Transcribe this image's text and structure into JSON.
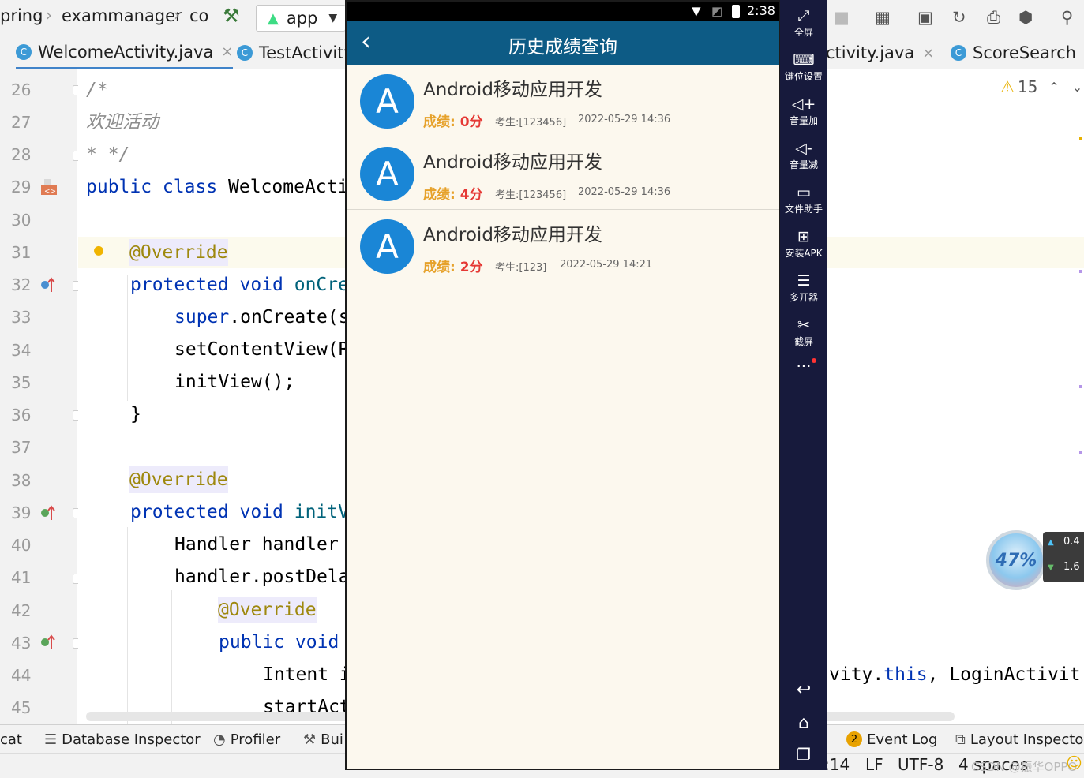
{
  "ide": {
    "breadcrumbs": [
      "pring",
      "exammanager",
      "co"
    ],
    "run_config": "app",
    "tabs": [
      {
        "label": "WelcomeActivity.java",
        "badge": "C"
      },
      {
        "label": "TestActivity",
        "badge": "C"
      },
      {
        "label": "ctivity.java",
        "badge": ""
      },
      {
        "label": "ScoreSearch",
        "badge": "C"
      }
    ],
    "warnings_count": "15",
    "line_numbers": [
      "26",
      "27",
      "28",
      "29",
      "30",
      "31",
      "32",
      "33",
      "34",
      "35",
      "36",
      "37",
      "38",
      "39",
      "40",
      "41",
      "42",
      "43",
      "44",
      "45"
    ],
    "code": {
      "l26": "/*",
      "l27": "欢迎活动",
      "l28": "* */",
      "l29_kw": "public class",
      "l29_name": " WelcomeActi",
      "l31": "@Override",
      "l32_kw": "protected void",
      "l32_name": " onCre",
      "l33_kw": "super",
      "l33_rest": ".onCreate(s",
      "l34": "setContentView(R",
      "l35": "initView();",
      "l36": "}",
      "l38": "@Override",
      "l39_kw": "protected void",
      "l39_name": " initV",
      "l40": "Handler handler",
      "l41": "handler.postDela",
      "l42": "@Override",
      "l43_kw": "public void",
      "l44": "Intent i",
      "l44_right_a": "vity.",
      "l44_right_kw": "this",
      "l44_right_b": ", LoginActivit",
      "l45": "startAct"
    },
    "tool_windows": [
      "cat",
      "Database Inspector",
      "Profiler",
      "Bui",
      "Event Log",
      "Layout Inspector"
    ],
    "event_log_badge": "2",
    "status": {
      "position": ":14",
      "line_sep": "LF",
      "encoding": "UTF-8",
      "indent": "4 spaces",
      "watermark": "CSDN @振华OPPO"
    },
    "perf_widget": {
      "percent": "47%",
      "up": "0.4",
      "down": "1.6"
    }
  },
  "emulator": {
    "clock": "2:38",
    "appbar_title": "历史成绩查询",
    "score_label": "成绩: ",
    "examinee_label": "考生:",
    "records": [
      {
        "avatar": "A",
        "course": "Android移动应用开发",
        "score": "0分",
        "examinee": "[123456]",
        "time": "2022-05-29 14:36"
      },
      {
        "avatar": "A",
        "course": "Android移动应用开发",
        "score": "4分",
        "examinee": "[123456]",
        "time": "2022-05-29 14:36"
      },
      {
        "avatar": "A",
        "course": "Android移动应用开发",
        "score": "2分",
        "examinee": "[123]",
        "time": "2022-05-29 14:21"
      }
    ],
    "sidebar": [
      {
        "label": "全屏",
        "icon": "fullscreen-icon"
      },
      {
        "label": "键位设置",
        "icon": "keyboard-icon"
      },
      {
        "label": "音量加",
        "icon": "volume-up-icon"
      },
      {
        "label": "音量减",
        "icon": "volume-down-icon"
      },
      {
        "label": "文件助手",
        "icon": "file-assistant-icon"
      },
      {
        "label": "安装APK",
        "icon": "install-apk-icon"
      },
      {
        "label": "多开器",
        "icon": "multi-instance-icon"
      },
      {
        "label": "截屏",
        "icon": "screenshot-icon"
      }
    ],
    "colors": {
      "appbar": "#0d5b85",
      "avatar": "#1a86d6",
      "score_label": "#e6a12a",
      "score_value": "#e53935",
      "sidebar": "#171a3c",
      "background": "#fcf8ee"
    }
  }
}
